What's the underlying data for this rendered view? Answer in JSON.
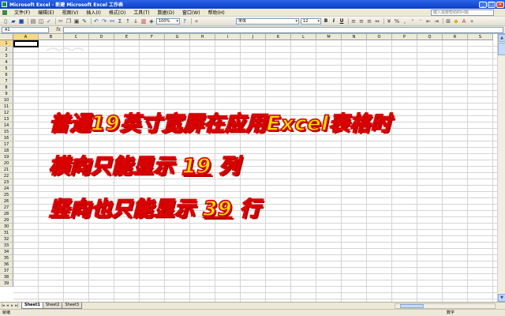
{
  "window": {
    "title": "Microsoft Excel - 新建 Microsoft Excel 工作表"
  },
  "menu": {
    "items": [
      "文件(F)",
      "编辑(E)",
      "视图(V)",
      "插入(I)",
      "格式(O)",
      "工具(T)",
      "数据(D)",
      "窗口(W)",
      "帮助(H)"
    ],
    "help_placeholder": "键入需要帮助的问题"
  },
  "toolbar": {
    "zoom": "100%",
    "font": "宋体",
    "font_size": "12",
    "bold": "B",
    "italic": "I",
    "underline": "U"
  },
  "formula_bar": {
    "name_box": "A1",
    "fx": "fx"
  },
  "grid": {
    "columns": [
      "A",
      "B",
      "C",
      "D",
      "E",
      "F",
      "G",
      "H",
      "I",
      "J",
      "K",
      "L",
      "M",
      "N",
      "O",
      "P",
      "Q",
      "R",
      "S"
    ],
    "rows": [
      "1",
      "2",
      "3",
      "4",
      "5",
      "6",
      "7",
      "8",
      "9",
      "10",
      "11",
      "12",
      "13",
      "14",
      "15",
      "16",
      "17",
      "18",
      "19",
      "20",
      "21",
      "22",
      "23",
      "24",
      "25",
      "26",
      "27",
      "28",
      "29",
      "30",
      "31",
      "32",
      "33",
      "34",
      "35",
      "36",
      "37",
      "38",
      "39"
    ],
    "active_column": "A",
    "active_row": "1"
  },
  "sheets": {
    "tabs": [
      "Sheet1",
      "Sheet2",
      "Sheet3"
    ],
    "active": "Sheet1"
  },
  "status": {
    "left": "就绪",
    "right": "数字"
  },
  "overlay": {
    "line1": "普通19英寸宽屏在应用Excel表格时",
    "line2_prefix": "横向只能显示",
    "line2_number": "19",
    "line2_suffix": "列",
    "line3_prefix": "竖向也只能显示",
    "line3_number": "39",
    "line3_suffix": "行"
  },
  "colors": {
    "overlay_fill": "#ffe000",
    "overlay_stroke": "#d80000",
    "titlebar": "#0a3fc8"
  }
}
